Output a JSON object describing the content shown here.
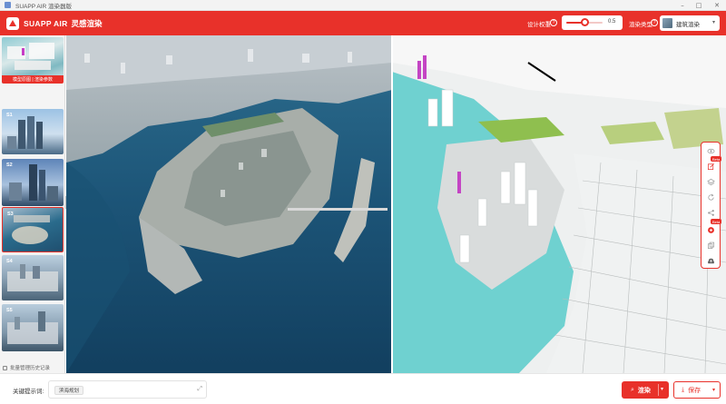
{
  "window": {
    "title": "SUAPP AIR 渲染器版",
    "minimize_icon": "minimize-icon",
    "maximize_icon": "maximize-icon",
    "close_icon": "close-icon"
  },
  "header": {
    "brand": "SUAPP AIR",
    "brand_sub": "灵感渲染",
    "design_weight_label": "设计权重",
    "weight_value": 0.5,
    "weight_value_text": "0.5",
    "render_style_label": "渲染类型",
    "render_style_value": "建筑渲染",
    "accent_color": "#e8312a"
  },
  "sidebar": {
    "items": [
      {
        "num": "",
        "caption": "模型原图 | 渲染参数",
        "active": false
      },
      {
        "num": "S1",
        "caption": "",
        "active": false
      },
      {
        "num": "S2",
        "caption": "",
        "active": false
      },
      {
        "num": "S3",
        "caption": "",
        "active": true
      },
      {
        "num": "S4",
        "caption": "",
        "active": false
      },
      {
        "num": "S5",
        "caption": "",
        "active": false
      }
    ],
    "batch_label": "批量管理历史记录"
  },
  "toolbar": {
    "icons": [
      "eye-icon",
      "edit-icon",
      "layers-icon",
      "refresh-icon",
      "share-icon",
      "target-icon",
      "copy-icon",
      "upload-icon"
    ],
    "badges": [
      "Beta",
      "Beta"
    ]
  },
  "bottom": {
    "keyword_label": "关键提示词:",
    "keyword_tag": "滨海规划",
    "render_label": "渲染",
    "save_label": "保存"
  }
}
